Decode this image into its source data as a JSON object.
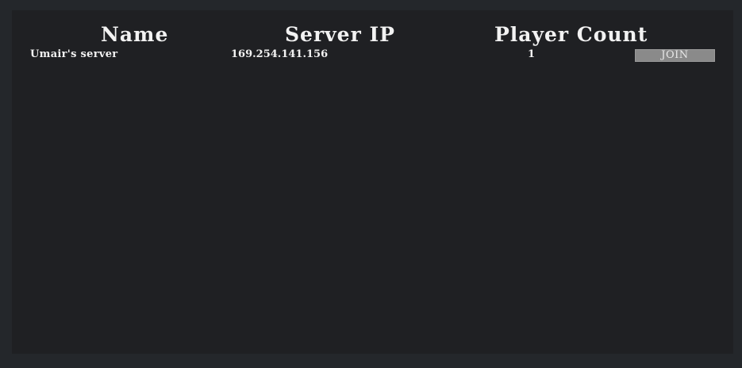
{
  "table": {
    "headers": {
      "name": "Name",
      "server_ip": "Server IP",
      "player_count": "Player Count"
    },
    "rows": [
      {
        "name": "Umair's server",
        "server_ip": "169.254.141.156",
        "player_count": "1",
        "join_label": "JOIN"
      }
    ]
  },
  "colors": {
    "background": "#24272b",
    "panel": "#1f2023",
    "text": "#f2f2f2",
    "join_button": "#8a8a8a"
  }
}
